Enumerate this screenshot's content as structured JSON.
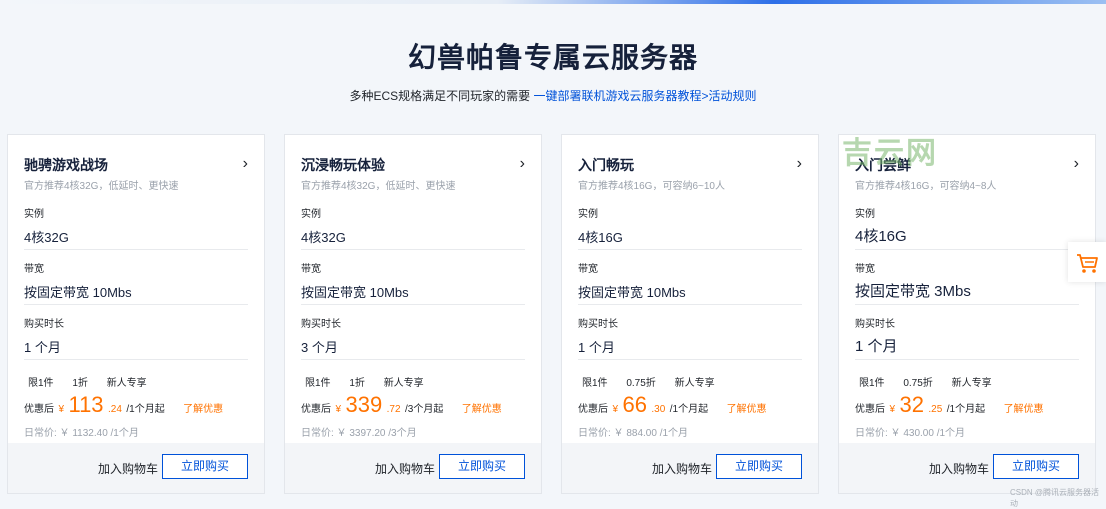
{
  "header": {
    "title": "幻兽帕鲁专属云服务器",
    "subtitle_text": "多种ECS规格满足不同玩家的需要",
    "subtitle_link": "一键部署联机游戏云服务器教程>活动规则"
  },
  "labels": {
    "instance": "实例",
    "bandwidth": "带宽",
    "duration": "购买时长",
    "discount_after": "优惠后",
    "currency": "¥",
    "learn_more": "了解优惠",
    "add_to_cart": "加入购物车",
    "buy_now": "立即购买",
    "daily_prefix": "日常价: ￥"
  },
  "cards": [
    {
      "title": "驰骋游戏战场",
      "desc": "官方推荐4核32G，低延时、更快速",
      "instance": "4核32G",
      "bandwidth": "按固定带宽 10Mbs",
      "duration": "1 个月",
      "tags": [
        "限1件",
        "1折",
        "新人专享"
      ],
      "price_int": "113",
      "price_dec": ".24",
      "price_unit": "/1个月起",
      "daily_price": "1132.40",
      "daily_unit": "/1个月"
    },
    {
      "title": "沉浸畅玩体验",
      "desc": "官方推荐4核32G，低延时、更快速",
      "instance": "4核32G",
      "bandwidth": "按固定带宽 10Mbs",
      "duration": "3 个月",
      "tags": [
        "限1件",
        "1折",
        "新人专享"
      ],
      "price_int": "339",
      "price_dec": ".72",
      "price_unit": "/3个月起",
      "daily_price": "3397.20",
      "daily_unit": "/3个月"
    },
    {
      "title": "入门畅玩",
      "desc": "官方推荐4核16G，可容纳6~10人",
      "instance": "4核16G",
      "bandwidth": "按固定带宽 10Mbs",
      "duration": "1 个月",
      "tags": [
        "限1件",
        "0.75折",
        "新人专享"
      ],
      "price_int": "66",
      "price_dec": ".30",
      "price_unit": "/1个月起",
      "daily_price": "884.00",
      "daily_unit": "/1个月"
    },
    {
      "title": "入门尝鲜",
      "desc": "官方推荐4核16G，可容纳4~8人",
      "instance": "4核16G",
      "bandwidth": "按固定带宽 3Mbs",
      "duration": "1 个月",
      "tags": [
        "限1件",
        "0.75折",
        "新人专享"
      ],
      "price_int": "32",
      "price_dec": ".25",
      "price_unit": "/1个月起",
      "daily_price": "430.00",
      "daily_unit": "/1个月"
    }
  ],
  "watermark": "吉云网",
  "footer_credit": "CSDN @腾讯云服务器活动",
  "colors": {
    "accent": "#0052d9",
    "price": "#ff7200",
    "watermark": "#7bb86f"
  }
}
